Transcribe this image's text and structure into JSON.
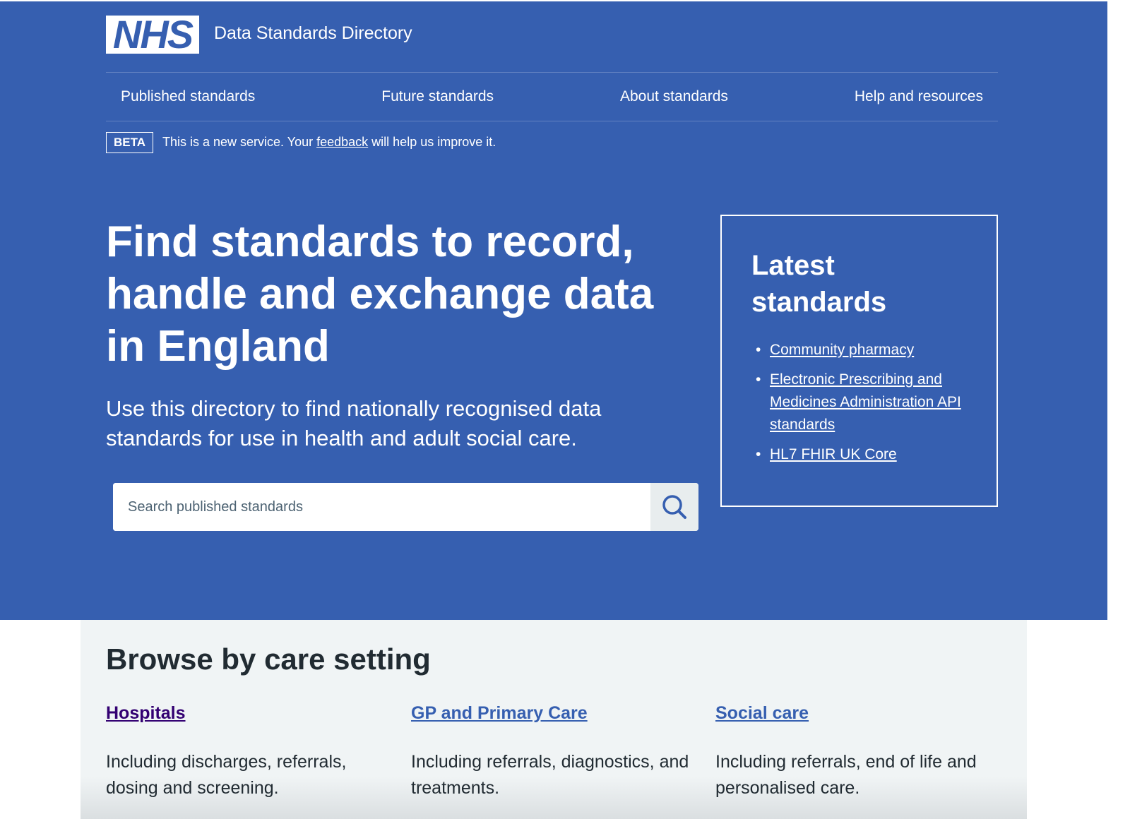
{
  "header": {
    "logo_text": "NHS",
    "service_name": "Data Standards Directory"
  },
  "nav": {
    "items": [
      {
        "label": "Published standards"
      },
      {
        "label": "Future standards"
      },
      {
        "label": "About standards"
      },
      {
        "label": "Help and resources"
      }
    ]
  },
  "beta": {
    "tag": "BETA",
    "text_before": "This is a new service. Your ",
    "link": "feedback",
    "text_after": " will help us improve it."
  },
  "hero": {
    "title": "Find standards to record, handle and exchange data in England",
    "description": "Use this directory to find nationally recognised data standards for use in health and adult social care."
  },
  "search": {
    "placeholder": "Search published standards",
    "value": ""
  },
  "latest": {
    "title": "Latest standards",
    "items": [
      {
        "label": "Community pharmacy"
      },
      {
        "label": "Electronic Prescribing and Medicines Administration API standards"
      },
      {
        "label": "HL7 FHIR UK Core"
      }
    ]
  },
  "browse": {
    "title": "Browse by care setting",
    "cards": [
      {
        "title": "Hospitals",
        "description": "Including discharges, referrals, dosing and screening.",
        "link_color": "#330072"
      },
      {
        "title": "GP and Primary Care",
        "description": "Including referrals, diagnostics, and treatments.",
        "link_color": "#365fb0"
      },
      {
        "title": "Social care",
        "description": "Including referrals, end of life and personalised care.",
        "link_color": "#365fb0"
      }
    ]
  },
  "colors": {
    "brand_blue": "#365fb0",
    "visited_link": "#330072",
    "text_dark": "#212b32",
    "section_gray": "#f0f4f5"
  }
}
